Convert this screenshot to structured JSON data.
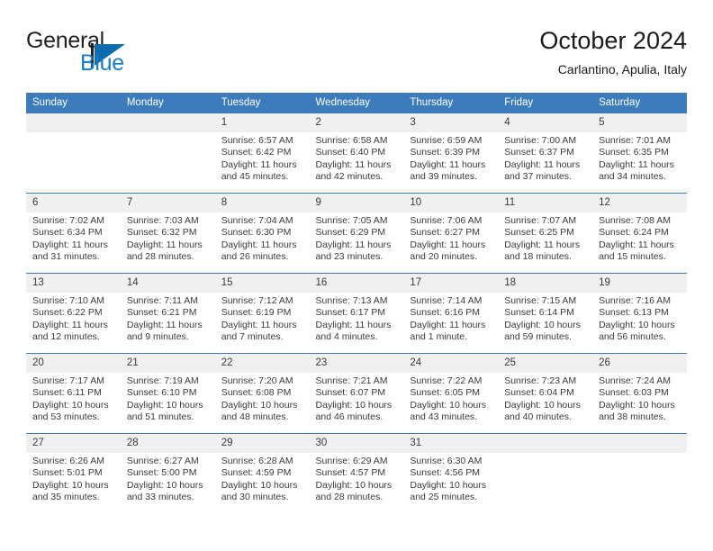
{
  "brand": {
    "name_top": "General",
    "name_bottom": "Blue",
    "flag_icon": "triangle-flag-icon",
    "color_primary": "#0b6cb0",
    "color_text": "#231f20"
  },
  "header": {
    "title": "October 2024",
    "subtitle": "Carlantino, Apulia, Italy"
  },
  "theme": {
    "header_blue": "#3c7cbc",
    "daynum_bg": "#f0f0f0",
    "text": "#3a3a3a"
  },
  "weekday_headers": [
    "Sunday",
    "Monday",
    "Tuesday",
    "Wednesday",
    "Thursday",
    "Friday",
    "Saturday"
  ],
  "weeks": [
    [
      {
        "day": "",
        "sunrise": "",
        "sunset": "",
        "daylight": ""
      },
      {
        "day": "",
        "sunrise": "",
        "sunset": "",
        "daylight": ""
      },
      {
        "day": "1",
        "sunrise": "Sunrise: 6:57 AM",
        "sunset": "Sunset: 6:42 PM",
        "daylight": "Daylight: 11 hours and 45 minutes."
      },
      {
        "day": "2",
        "sunrise": "Sunrise: 6:58 AM",
        "sunset": "Sunset: 6:40 PM",
        "daylight": "Daylight: 11 hours and 42 minutes."
      },
      {
        "day": "3",
        "sunrise": "Sunrise: 6:59 AM",
        "sunset": "Sunset: 6:39 PM",
        "daylight": "Daylight: 11 hours and 39 minutes."
      },
      {
        "day": "4",
        "sunrise": "Sunrise: 7:00 AM",
        "sunset": "Sunset: 6:37 PM",
        "daylight": "Daylight: 11 hours and 37 minutes."
      },
      {
        "day": "5",
        "sunrise": "Sunrise: 7:01 AM",
        "sunset": "Sunset: 6:35 PM",
        "daylight": "Daylight: 11 hours and 34 minutes."
      }
    ],
    [
      {
        "day": "6",
        "sunrise": "Sunrise: 7:02 AM",
        "sunset": "Sunset: 6:34 PM",
        "daylight": "Daylight: 11 hours and 31 minutes."
      },
      {
        "day": "7",
        "sunrise": "Sunrise: 7:03 AM",
        "sunset": "Sunset: 6:32 PM",
        "daylight": "Daylight: 11 hours and 28 minutes."
      },
      {
        "day": "8",
        "sunrise": "Sunrise: 7:04 AM",
        "sunset": "Sunset: 6:30 PM",
        "daylight": "Daylight: 11 hours and 26 minutes."
      },
      {
        "day": "9",
        "sunrise": "Sunrise: 7:05 AM",
        "sunset": "Sunset: 6:29 PM",
        "daylight": "Daylight: 11 hours and 23 minutes."
      },
      {
        "day": "10",
        "sunrise": "Sunrise: 7:06 AM",
        "sunset": "Sunset: 6:27 PM",
        "daylight": "Daylight: 11 hours and 20 minutes."
      },
      {
        "day": "11",
        "sunrise": "Sunrise: 7:07 AM",
        "sunset": "Sunset: 6:25 PM",
        "daylight": "Daylight: 11 hours and 18 minutes."
      },
      {
        "day": "12",
        "sunrise": "Sunrise: 7:08 AM",
        "sunset": "Sunset: 6:24 PM",
        "daylight": "Daylight: 11 hours and 15 minutes."
      }
    ],
    [
      {
        "day": "13",
        "sunrise": "Sunrise: 7:10 AM",
        "sunset": "Sunset: 6:22 PM",
        "daylight": "Daylight: 11 hours and 12 minutes."
      },
      {
        "day": "14",
        "sunrise": "Sunrise: 7:11 AM",
        "sunset": "Sunset: 6:21 PM",
        "daylight": "Daylight: 11 hours and 9 minutes."
      },
      {
        "day": "15",
        "sunrise": "Sunrise: 7:12 AM",
        "sunset": "Sunset: 6:19 PM",
        "daylight": "Daylight: 11 hours and 7 minutes."
      },
      {
        "day": "16",
        "sunrise": "Sunrise: 7:13 AM",
        "sunset": "Sunset: 6:17 PM",
        "daylight": "Daylight: 11 hours and 4 minutes."
      },
      {
        "day": "17",
        "sunrise": "Sunrise: 7:14 AM",
        "sunset": "Sunset: 6:16 PM",
        "daylight": "Daylight: 11 hours and 1 minute."
      },
      {
        "day": "18",
        "sunrise": "Sunrise: 7:15 AM",
        "sunset": "Sunset: 6:14 PM",
        "daylight": "Daylight: 10 hours and 59 minutes."
      },
      {
        "day": "19",
        "sunrise": "Sunrise: 7:16 AM",
        "sunset": "Sunset: 6:13 PM",
        "daylight": "Daylight: 10 hours and 56 minutes."
      }
    ],
    [
      {
        "day": "20",
        "sunrise": "Sunrise: 7:17 AM",
        "sunset": "Sunset: 6:11 PM",
        "daylight": "Daylight: 10 hours and 53 minutes."
      },
      {
        "day": "21",
        "sunrise": "Sunrise: 7:19 AM",
        "sunset": "Sunset: 6:10 PM",
        "daylight": "Daylight: 10 hours and 51 minutes."
      },
      {
        "day": "22",
        "sunrise": "Sunrise: 7:20 AM",
        "sunset": "Sunset: 6:08 PM",
        "daylight": "Daylight: 10 hours and 48 minutes."
      },
      {
        "day": "23",
        "sunrise": "Sunrise: 7:21 AM",
        "sunset": "Sunset: 6:07 PM",
        "daylight": "Daylight: 10 hours and 46 minutes."
      },
      {
        "day": "24",
        "sunrise": "Sunrise: 7:22 AM",
        "sunset": "Sunset: 6:05 PM",
        "daylight": "Daylight: 10 hours and 43 minutes."
      },
      {
        "day": "25",
        "sunrise": "Sunrise: 7:23 AM",
        "sunset": "Sunset: 6:04 PM",
        "daylight": "Daylight: 10 hours and 40 minutes."
      },
      {
        "day": "26",
        "sunrise": "Sunrise: 7:24 AM",
        "sunset": "Sunset: 6:03 PM",
        "daylight": "Daylight: 10 hours and 38 minutes."
      }
    ],
    [
      {
        "day": "27",
        "sunrise": "Sunrise: 6:26 AM",
        "sunset": "Sunset: 5:01 PM",
        "daylight": "Daylight: 10 hours and 35 minutes."
      },
      {
        "day": "28",
        "sunrise": "Sunrise: 6:27 AM",
        "sunset": "Sunset: 5:00 PM",
        "daylight": "Daylight: 10 hours and 33 minutes."
      },
      {
        "day": "29",
        "sunrise": "Sunrise: 6:28 AM",
        "sunset": "Sunset: 4:59 PM",
        "daylight": "Daylight: 10 hours and 30 minutes."
      },
      {
        "day": "30",
        "sunrise": "Sunrise: 6:29 AM",
        "sunset": "Sunset: 4:57 PM",
        "daylight": "Daylight: 10 hours and 28 minutes."
      },
      {
        "day": "31",
        "sunrise": "Sunrise: 6:30 AM",
        "sunset": "Sunset: 4:56 PM",
        "daylight": "Daylight: 10 hours and 25 minutes."
      },
      {
        "day": "",
        "sunrise": "",
        "sunset": "",
        "daylight": ""
      },
      {
        "day": "",
        "sunrise": "",
        "sunset": "",
        "daylight": ""
      }
    ]
  ]
}
